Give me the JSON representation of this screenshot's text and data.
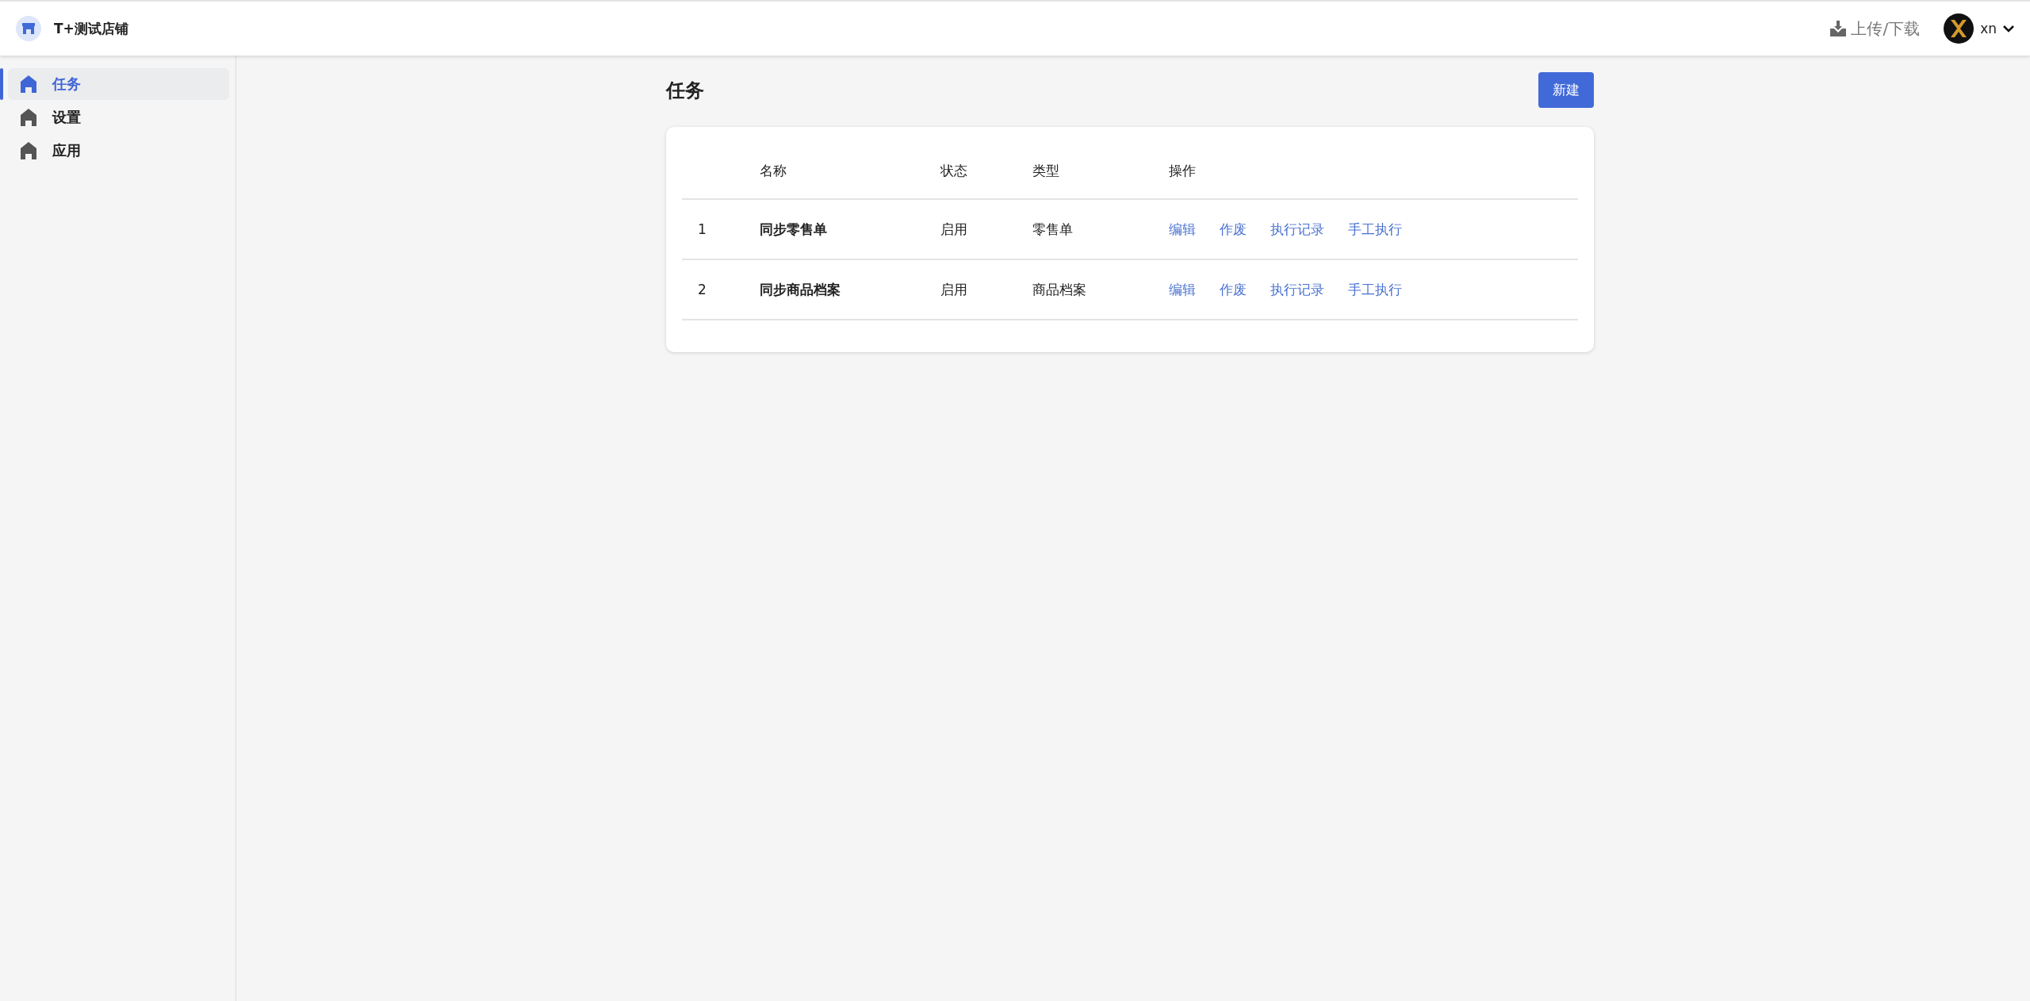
{
  "header": {
    "shop_name": "T+测试店铺",
    "upload_download": "上传/下载",
    "user": "xn"
  },
  "sidebar": {
    "items": [
      {
        "label": "任务",
        "selected": true
      },
      {
        "label": "设置",
        "selected": false
      },
      {
        "label": "应用",
        "selected": false
      }
    ]
  },
  "page": {
    "title": "任务",
    "new_button": "新建"
  },
  "table": {
    "columns": [
      "名称",
      "状态",
      "类型",
      "操作"
    ],
    "rows": [
      {
        "index": "1",
        "name": "同步零售单",
        "status": "启用",
        "type": "零售单",
        "actions": [
          "编辑",
          "作废",
          "执行记录",
          "手工执行"
        ]
      },
      {
        "index": "2",
        "name": "同步商品档案",
        "status": "启用",
        "type": "商品档案",
        "actions": [
          "编辑",
          "作废",
          "执行记录",
          "手工执行"
        ]
      }
    ]
  }
}
